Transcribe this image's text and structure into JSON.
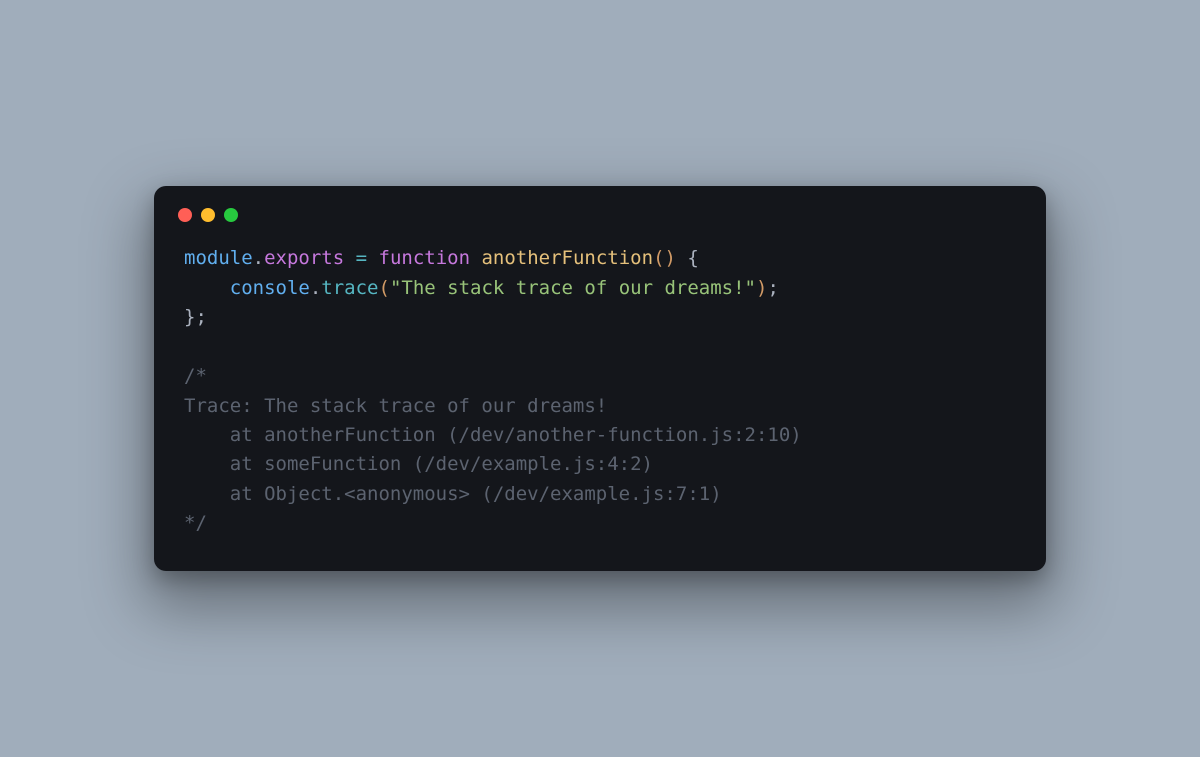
{
  "colors": {
    "bg": "#a0adbb",
    "window": "#14161b",
    "red": "#ff5f56",
    "yellow": "#ffbd2e",
    "green": "#27c93f"
  },
  "code": {
    "l1": {
      "module": "module",
      "dot": ".",
      "exports": "exports",
      "eq": " = ",
      "function_kw": "function",
      "space": " ",
      "fn_name": "anotherFunction",
      "lpar": "(",
      "rpar": ") ",
      "lbrace": "{"
    },
    "l2": {
      "indent": "    ",
      "console": "console",
      "dot": ".",
      "trace": "trace",
      "lpar": "(",
      "str": "\"The stack trace of our dreams!\"",
      "rpar": ")",
      "semi": ";"
    },
    "l3": {
      "rbrace": "}",
      "semi": ";"
    },
    "comment": {
      "open": "/*",
      "t1": "Trace: The stack trace of our dreams!",
      "t2": "    at anotherFunction (/dev/another-function.js:2:10)",
      "t3": "    at someFunction (/dev/example.js:4:2)",
      "t4": "    at Object.<anonymous> (/dev/example.js:7:1)",
      "close": "*/"
    }
  }
}
